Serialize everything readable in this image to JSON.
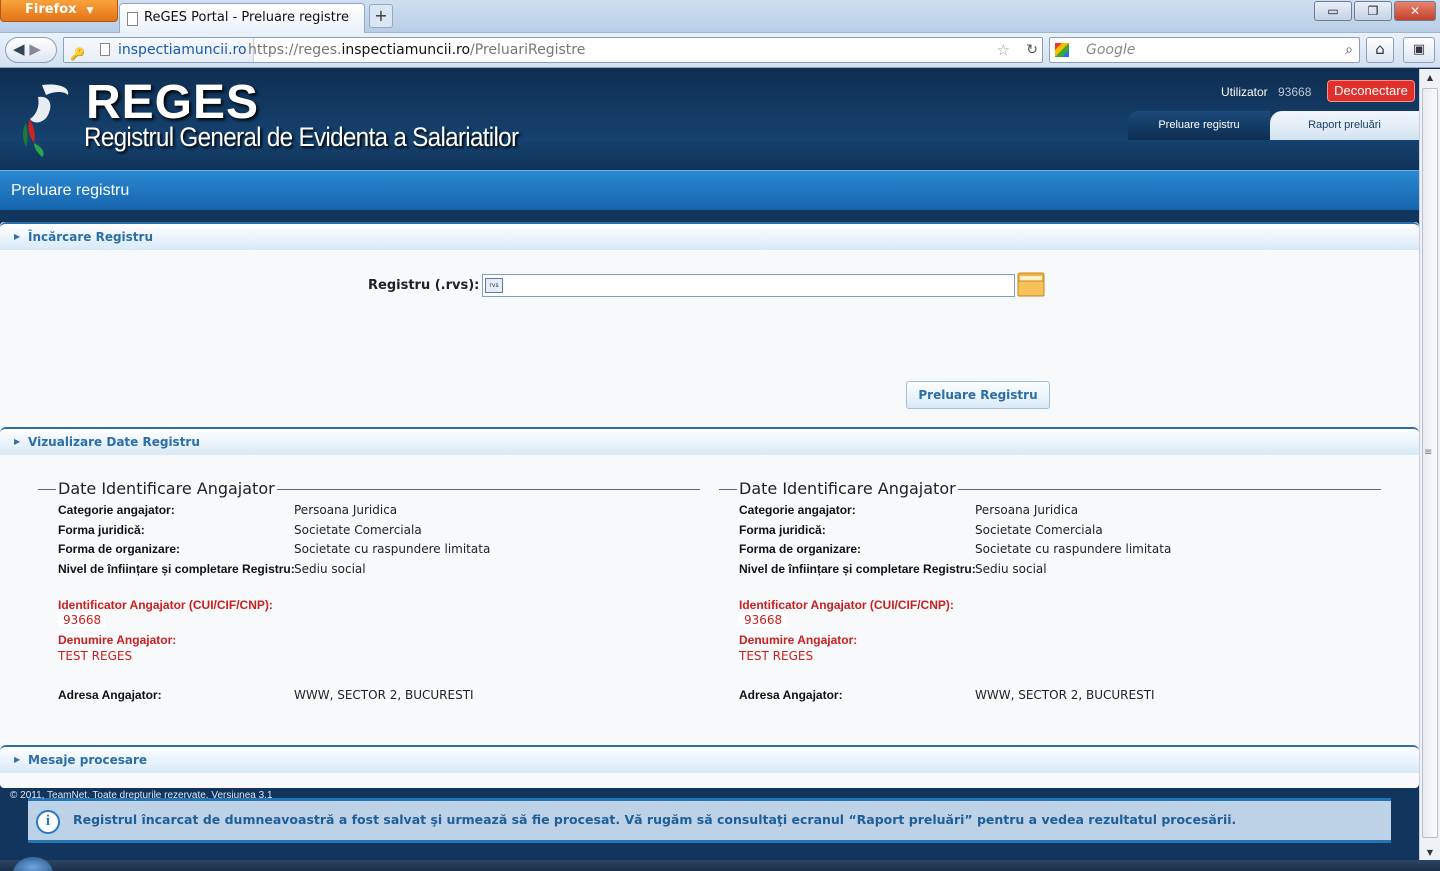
{
  "browser": {
    "menu_label": "Firefox",
    "tab_title": "ReGES Portal - Preluare registre",
    "new_tab": "+",
    "site_identity": "inspectiamuncii.ro",
    "url_prefix": "https://reges.",
    "url_domain": "inspectiamuncii.ro",
    "url_path": "/PreluariRegistre",
    "search_placeholder": "Google",
    "window_buttons": {
      "minimize": "▭",
      "restore": "❐",
      "close": "✕"
    }
  },
  "header": {
    "brand": "REGES",
    "subtitle": "Registrul General de Evidenta a Salariatilor",
    "user_label": "Utilizator",
    "user_id": "93668",
    "logout_label": "Deconectare",
    "tabs": [
      {
        "label": "Preluare registru",
        "active": true
      },
      {
        "label": "Raport preluări",
        "active": false
      }
    ]
  },
  "page_title": "Preluare registru",
  "upload_section": {
    "title": "Încărcare Registru",
    "field_label": "Registru (.rvs):",
    "field_value": "",
    "submit_label": "Preluare Registru"
  },
  "view_section": {
    "title": "Vizualizare Date Registru",
    "columns": [
      {
        "title": "Date Identificare Angajator",
        "category_label": "Categorie angajator:",
        "category_value": "Persoana Juridica",
        "legal_form_label": "Forma juridică:",
        "legal_form_value": "Societate Comerciala",
        "org_form_label": "Forma de organizare:",
        "org_form_value": "Societate cu raspundere limitata",
        "level_label": "Nivel de înființare și completare Registru:",
        "level_value": "Sediu social",
        "id_label": "Identificator Angajator (CUI/CIF/CNP):",
        "id_value": "93668",
        "name_label": "Denumire Angajator:",
        "name_value": "TEST REGES",
        "address_label": "Adresa Angajator:",
        "address_value": "WWW, SECTOR 2, BUCURESTI"
      },
      {
        "title": "Date Identificare Angajator",
        "category_label": "Categorie angajator:",
        "category_value": "Persoana Juridica",
        "legal_form_label": "Forma juridică:",
        "legal_form_value": "Societate Comerciala",
        "org_form_label": "Forma de organizare:",
        "org_form_value": "Societate cu raspundere limitata",
        "level_label": "Nivel de înființare și completare Registru:",
        "level_value": "Sediu social",
        "id_label": "Identificator Angajator (CUI/CIF/CNP):",
        "id_value": "93668",
        "name_label": "Denumire Angajator:",
        "name_value": "TEST REGES",
        "address_label": "Adresa Angajator:",
        "address_value": "WWW, SECTOR 2, BUCURESTI"
      }
    ]
  },
  "messages_section": {
    "title": "Mesaje procesare",
    "info_message": "Registrul încarcat de dumneavoastră a fost salvat şi urmează să fie procesat. Vă rugăm să consultaţi ecranul “Raport preluări” pentru a vedea rezultatul procesării."
  },
  "footer": "© 2011, TeamNet. Toate drepturile rezervate. Versiunea 3.1",
  "colors": {
    "header_dark": "#0f2e52",
    "title_bar_blue": "#1f78c4",
    "logout_red": "#e0302a",
    "error_red": "#cc1f1f",
    "section_blue": "#2b6ea8"
  }
}
